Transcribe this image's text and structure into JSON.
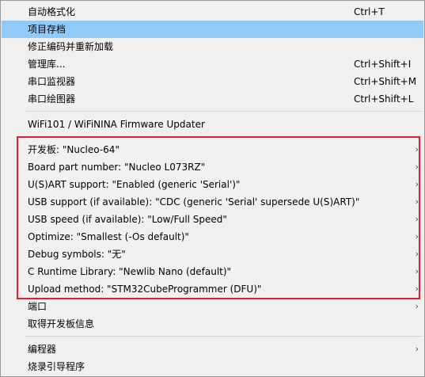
{
  "menu": {
    "group1": [
      {
        "label": "自动格式化",
        "shortcut": "Ctrl+T"
      },
      {
        "label": "项目存档",
        "shortcut": ""
      },
      {
        "label": "修正编码并重新加载",
        "shortcut": ""
      },
      {
        "label": "管理库...",
        "shortcut": "Ctrl+Shift+I"
      },
      {
        "label": "串口监视器",
        "shortcut": "Ctrl+Shift+M"
      },
      {
        "label": "串口绘图器",
        "shortcut": "Ctrl+Shift+L"
      }
    ],
    "group2": [
      {
        "label": "WiFi101 / WiFiNINA Firmware Updater"
      }
    ],
    "board_options": [
      {
        "label": "开发板: \"Nucleo-64\""
      },
      {
        "label": "Board part number: \"Nucleo L073RZ\""
      },
      {
        "label": "U(S)ART support: \"Enabled (generic 'Serial')\""
      },
      {
        "label": "USB support (if available): \"CDC (generic 'Serial' supersede U(S)ART)\""
      },
      {
        "label": "USB speed (if available): \"Low/Full Speed\""
      },
      {
        "label": "Optimize: \"Smallest (-Os default)\""
      },
      {
        "label": "Debug symbols: \"无\""
      },
      {
        "label": "C Runtime Library: \"Newlib Nano (default)\""
      },
      {
        "label": "Upload method: \"STM32CubeProgrammer (DFU)\""
      }
    ],
    "board_more": [
      {
        "label": "端口"
      },
      {
        "label": "取得开发板信息"
      }
    ],
    "group4": [
      {
        "label": "编程器"
      },
      {
        "label": "烧录引导程序"
      }
    ],
    "submenu_arrow": "›"
  },
  "colors": {
    "selected_bg": "#91c9f7",
    "highlight_border": "#e02030",
    "menu_bg": "#f0f0f0"
  }
}
